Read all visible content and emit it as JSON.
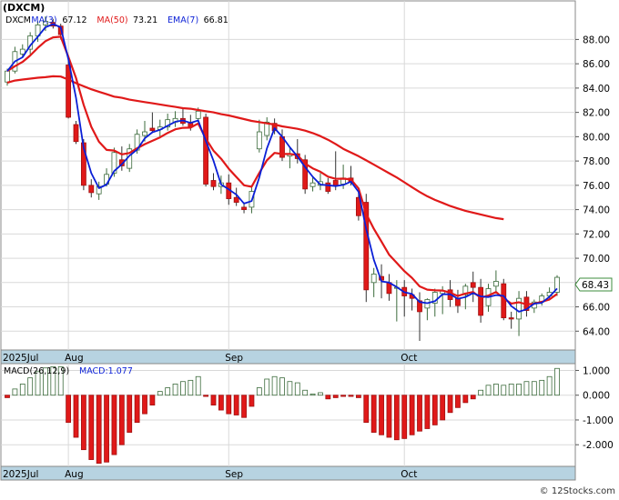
{
  "chart_data": [
    {
      "type": "candlestick",
      "ticker_label": "(DXCM)",
      "legend": [
        {
          "label": "DXCM",
          "value": "",
          "color": "#000000"
        },
        {
          "label": "MA(3)",
          "value": "67.12",
          "color": "#0a1fd6"
        },
        {
          "label": "MA(50)",
          "value": "73.21",
          "color": "#e01919"
        },
        {
          "label": "EMA(7)",
          "value": "66.81",
          "color": "#0a1fd6"
        }
      ],
      "last_price": "68.43",
      "ylim": [
        62.6,
        90.2
      ],
      "y_ticks": [
        64,
        66,
        68,
        70,
        72,
        74,
        76,
        78,
        80,
        82,
        84,
        86,
        88
      ],
      "y_tick_labels": [
        "64.00",
        "66.00",
        "68.00",
        "70.00",
        "72.00",
        "74.00",
        "76.00",
        "78.00",
        "80.00",
        "82.00",
        "84.00",
        "86.00",
        "88.00"
      ],
      "x_labels": [
        {
          "label": "2025Jul",
          "index": 0
        },
        {
          "label": "Aug",
          "index": 8
        },
        {
          "label": "Sep",
          "index": 29
        },
        {
          "label": "Oct",
          "index": 52
        }
      ],
      "colors": {
        "up": "#ffffff",
        "down": "#e01919",
        "up_border": "#3c6b3c",
        "ma_red": "#e01919",
        "ma_blue": "#0a1fd6"
      },
      "ohlc": [
        [
          84.5,
          85.6,
          84.2,
          85.4
        ],
        [
          85.4,
          87.4,
          85.2,
          87.0
        ],
        [
          86.8,
          87.6,
          86.5,
          87.2
        ],
        [
          87.2,
          88.6,
          86.8,
          88.3
        ],
        [
          88.3,
          89.5,
          87.8,
          89.2
        ],
        [
          89.2,
          89.9,
          88.7,
          89.5
        ],
        [
          89.4,
          89.7,
          88.9,
          89.1
        ],
        [
          89.1,
          89.3,
          88.0,
          88.4
        ],
        [
          85.9,
          86.7,
          81.5,
          81.6
        ],
        [
          81.0,
          81.3,
          79.4,
          79.6
        ],
        [
          79.5,
          79.8,
          75.6,
          76.0
        ],
        [
          76.0,
          76.5,
          75.0,
          75.4
        ],
        [
          75.3,
          76.3,
          74.8,
          75.9
        ],
        [
          76.1,
          77.4,
          75.9,
          76.9
        ],
        [
          77.0,
          79.1,
          76.7,
          78.7
        ],
        [
          78.1,
          79.2,
          77.2,
          77.6
        ],
        [
          77.4,
          79.4,
          77.1,
          79.0
        ],
        [
          78.9,
          80.6,
          78.6,
          80.2
        ],
        [
          80.1,
          81.3,
          79.6,
          80.4
        ],
        [
          80.7,
          82.0,
          80.3,
          80.5
        ],
        [
          80.6,
          81.4,
          80.0,
          80.8
        ],
        [
          80.8,
          81.9,
          80.5,
          81.4
        ],
        [
          81.2,
          82.1,
          80.8,
          81.5
        ],
        [
          81.5,
          82.3,
          80.9,
          81.1
        ],
        [
          81.2,
          81.8,
          80.5,
          80.8
        ],
        [
          81.5,
          82.4,
          81.2,
          82.1
        ],
        [
          81.6,
          81.9,
          75.9,
          76.1
        ],
        [
          76.4,
          77.0,
          75.6,
          75.9
        ],
        [
          75.9,
          76.8,
          75.3,
          76.2
        ],
        [
          76.2,
          76.9,
          74.4,
          74.9
        ],
        [
          75.0,
          75.8,
          74.3,
          74.6
        ],
        [
          74.2,
          74.6,
          73.7,
          74.0
        ],
        [
          74.2,
          75.9,
          73.7,
          75.5
        ],
        [
          79.0,
          81.4,
          78.7,
          80.4
        ],
        [
          80.1,
          81.6,
          79.7,
          81.2
        ],
        [
          81.1,
          81.5,
          80.2,
          80.5
        ],
        [
          80.0,
          80.6,
          78.0,
          78.3
        ],
        [
          78.4,
          79.1,
          77.4,
          78.6
        ],
        [
          78.6,
          79.8,
          77.8,
          78.2
        ],
        [
          78.1,
          78.5,
          75.3,
          75.7
        ],
        [
          75.9,
          76.7,
          75.5,
          76.2
        ],
        [
          76.0,
          77.0,
          75.6,
          76.3
        ],
        [
          76.2,
          76.6,
          75.3,
          75.5
        ],
        [
          76.4,
          78.8,
          75.6,
          76.0
        ],
        [
          76.1,
          77.7,
          75.7,
          76.6
        ],
        [
          76.6,
          77.6,
          76.0,
          76.3
        ],
        [
          75.0,
          75.4,
          73.1,
          73.5
        ],
        [
          74.6,
          75.3,
          66.4,
          67.4
        ],
        [
          68.0,
          69.2,
          66.8,
          68.7
        ],
        [
          68.5,
          69.5,
          66.7,
          68.2
        ],
        [
          68.0,
          68.7,
          66.5,
          67.1
        ],
        [
          67.6,
          68.2,
          64.8,
          67.6
        ],
        [
          67.6,
          68.2,
          65.2,
          66.9
        ],
        [
          67.0,
          67.5,
          65.7,
          66.7
        ],
        [
          66.5,
          67.2,
          63.2,
          65.6
        ],
        [
          65.9,
          66.7,
          64.9,
          66.6
        ],
        [
          66.3,
          67.5,
          65.2,
          67.2
        ],
        [
          67.1,
          67.7,
          65.4,
          67.3
        ],
        [
          67.4,
          68.2,
          66.0,
          66.6
        ],
        [
          66.7,
          67.4,
          65.5,
          66.1
        ],
        [
          67.0,
          67.9,
          65.8,
          67.7
        ],
        [
          68.0,
          68.9,
          66.4,
          67.6
        ],
        [
          67.6,
          68.3,
          64.7,
          65.3
        ],
        [
          66.1,
          67.9,
          65.6,
          67.5
        ],
        [
          67.7,
          69.0,
          67.1,
          68.1
        ],
        [
          67.9,
          68.3,
          64.9,
          65.1
        ],
        [
          65.1,
          65.6,
          64.2,
          65.0
        ],
        [
          65.0,
          67.3,
          63.6,
          66.7
        ],
        [
          66.8,
          67.3,
          65.2,
          65.7
        ],
        [
          65.9,
          66.6,
          65.5,
          66.4
        ],
        [
          66.4,
          67.1,
          66.1,
          66.9
        ],
        [
          66.9,
          67.6,
          66.6,
          67.2
        ],
        [
          67.2,
          68.6,
          66.9,
          68.43
        ]
      ],
      "ma50": [
        84.45,
        84.62,
        84.7,
        84.78,
        84.85,
        84.9,
        84.97,
        84.95,
        84.7,
        84.4,
        84.15,
        83.9,
        83.7,
        83.5,
        83.3,
        83.2,
        83.05,
        82.95,
        82.85,
        82.75,
        82.65,
        82.55,
        82.45,
        82.35,
        82.3,
        82.2,
        82.1,
        82.0,
        81.85,
        81.75,
        81.6,
        81.45,
        81.3,
        81.2,
        81.1,
        81.0,
        80.85,
        80.75,
        80.65,
        80.5,
        80.3,
        80.05,
        79.75,
        79.4,
        79.0,
        78.7,
        78.4,
        78.05,
        77.7,
        77.35,
        77.0,
        76.65,
        76.25,
        75.85,
        75.45,
        75.1,
        74.8,
        74.55,
        74.3,
        74.1,
        73.9,
        73.75,
        73.6,
        73.45,
        73.3,
        73.21
      ]
    },
    {
      "type": "bar",
      "title": "MACD(26,12,9)",
      "value_label": "MACD:1.077",
      "ylim": [
        -2.8,
        1.2
      ],
      "y_ticks": [
        -2,
        -1,
        0,
        1
      ],
      "y_tick_labels": [
        "-2.000",
        "-1.000",
        "0.000",
        "1.000"
      ],
      "x_labels": [
        {
          "label": "2025Jul",
          "index": 0
        },
        {
          "label": "Aug",
          "index": 8
        },
        {
          "label": "Sep",
          "index": 29
        },
        {
          "label": "Oct",
          "index": 52
        }
      ],
      "colors": {
        "up": "#ffffff",
        "up_border": "#3c6b3c",
        "down": "#e01919"
      },
      "values": [
        -0.1,
        0.25,
        0.45,
        0.7,
        0.95,
        1.1,
        1.15,
        1.15,
        -1.1,
        -1.7,
        -2.2,
        -2.6,
        -2.75,
        -2.7,
        -2.4,
        -2.0,
        -1.5,
        -1.1,
        -0.75,
        -0.4,
        0.15,
        0.3,
        0.45,
        0.55,
        0.6,
        0.75,
        -0.05,
        -0.4,
        -0.6,
        -0.75,
        -0.8,
        -0.9,
        -0.45,
        0.3,
        0.65,
        0.75,
        0.7,
        0.55,
        0.5,
        0.2,
        0.05,
        0.1,
        -0.15,
        -0.1,
        -0.05,
        -0.05,
        -0.1,
        -1.1,
        -1.5,
        -1.6,
        -1.7,
        -1.8,
        -1.75,
        -1.6,
        -1.45,
        -1.35,
        -1.2,
        -1.0,
        -0.7,
        -0.5,
        -0.3,
        -0.15,
        0.2,
        0.4,
        0.45,
        0.4,
        0.45,
        0.45,
        0.55,
        0.55,
        0.6,
        0.75,
        1.08
      ]
    }
  ],
  "watermark": "© 12Stocks.com"
}
